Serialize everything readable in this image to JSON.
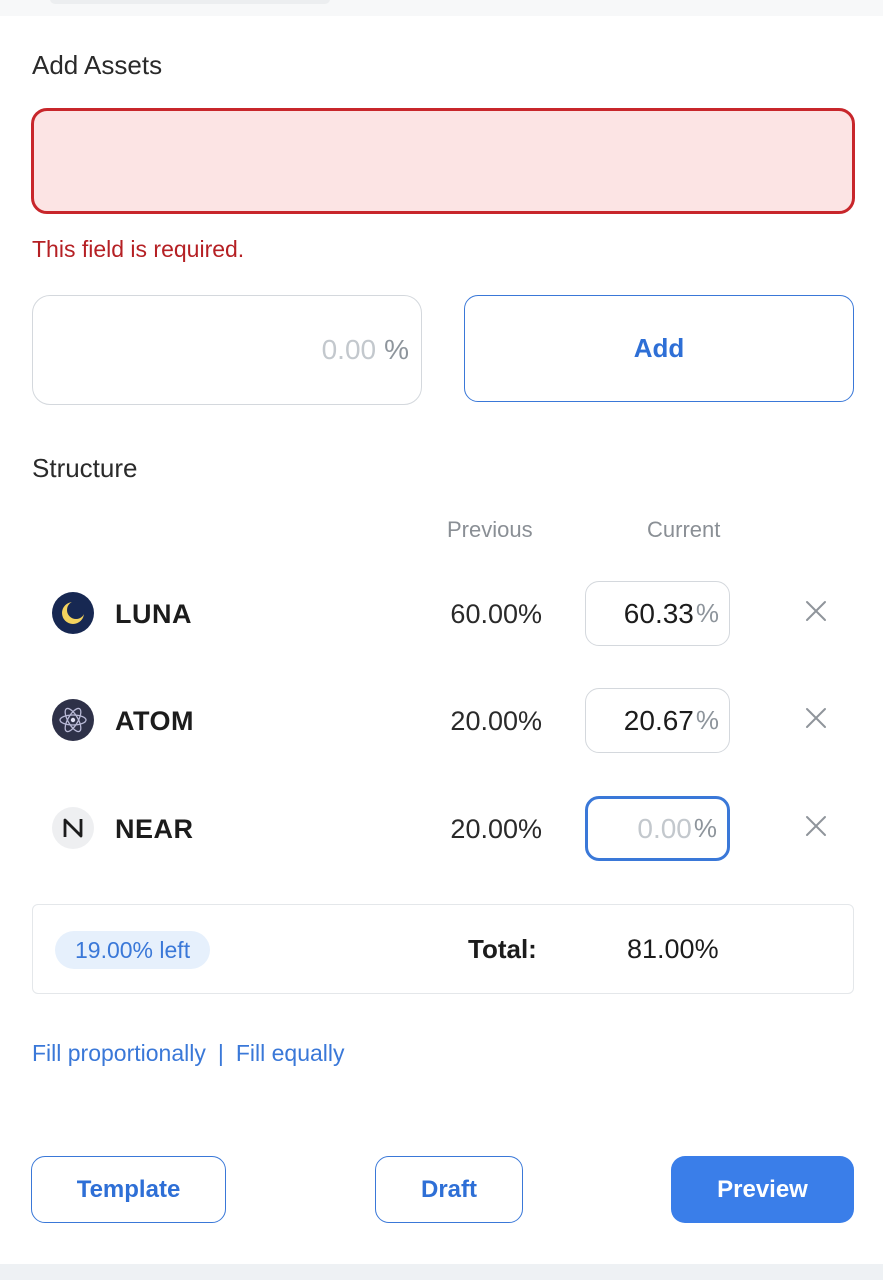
{
  "add_assets": {
    "label": "Add Assets",
    "input_value": "",
    "error": "This field is required."
  },
  "percent_input": {
    "placeholder": "0.00",
    "unit": "%"
  },
  "add_button": "Add",
  "structure": {
    "label": "Structure",
    "col_previous": "Previous",
    "col_current": "Current",
    "rows": [
      {
        "icon": "luna-icon",
        "name": "LUNA",
        "previous": "60.00%",
        "current": "60.33",
        "unit": "%"
      },
      {
        "icon": "atom-icon",
        "name": "ATOM",
        "previous": "20.00%",
        "current": "20.67",
        "unit": "%"
      },
      {
        "icon": "near-icon",
        "name": "NEAR",
        "previous": "20.00%",
        "current": "",
        "placeholder": "0.00",
        "unit": "%"
      }
    ]
  },
  "summary": {
    "left_badge": "19.00% left",
    "total_label": "Total:",
    "total_value": "81.00%"
  },
  "fill_links": {
    "proportional": "Fill proportionally",
    "separator": "|",
    "equal": "Fill equally"
  },
  "buttons": {
    "template": "Template",
    "draft": "Draft",
    "preview": "Preview"
  },
  "colors": {
    "accent": "#3a78d8",
    "error": "#c8262b",
    "error_bg": "#fce4e4",
    "luna": "#172852",
    "atom": "#2e3148"
  }
}
